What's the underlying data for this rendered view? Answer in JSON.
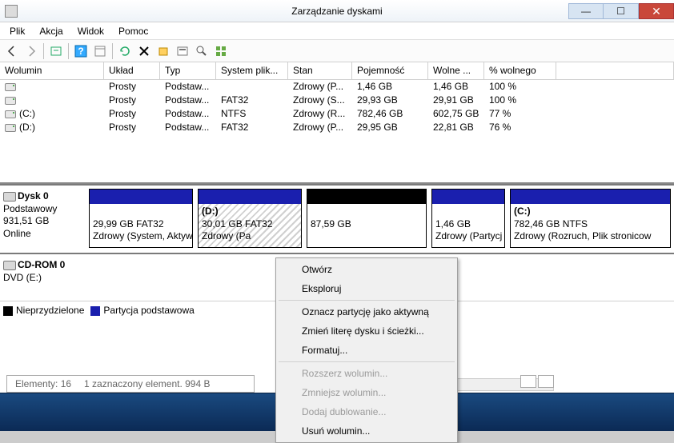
{
  "window": {
    "title": "Zarządzanie dyskami"
  },
  "menu": {
    "file": "Plik",
    "action": "Akcja",
    "view": "Widok",
    "help": "Pomoc"
  },
  "columns": {
    "volume": "Wolumin",
    "layout": "Układ",
    "type": "Typ",
    "fs": "System plik...",
    "status": "Stan",
    "capacity": "Pojemność",
    "free": "Wolne ...",
    "pct": "% wolnego"
  },
  "volumes": [
    {
      "name": "",
      "layout": "Prosty",
      "type": "Podstaw...",
      "fs": "",
      "status": "Zdrowy (P...",
      "cap": "1,46 GB",
      "free": "1,46 GB",
      "pct": "100 %"
    },
    {
      "name": "",
      "layout": "Prosty",
      "type": "Podstaw...",
      "fs": "FAT32",
      "status": "Zdrowy (S...",
      "cap": "29,93 GB",
      "free": "29,91 GB",
      "pct": "100 %"
    },
    {
      "name": "(C:)",
      "layout": "Prosty",
      "type": "Podstaw...",
      "fs": "NTFS",
      "status": "Zdrowy (R...",
      "cap": "782,46 GB",
      "free": "602,75 GB",
      "pct": "77 %"
    },
    {
      "name": "(D:)",
      "layout": "Prosty",
      "type": "Podstaw...",
      "fs": "FAT32",
      "status": "Zdrowy (P...",
      "cap": "29,95 GB",
      "free": "22,81 GB",
      "pct": "76 %"
    }
  ],
  "disk0": {
    "name": "Dysk 0",
    "type": "Podstawowy",
    "size": "931,51 GB",
    "status": "Online",
    "parts": {
      "p1": {
        "l1": "29,99 GB FAT32",
        "l2": "Zdrowy (System, Aktyw"
      },
      "p2": {
        "name": "(D:)",
        "l1": "30,01 GB FAT32",
        "l2": "Zdrowy (Pa"
      },
      "p3": {
        "l1": "87,59 GB"
      },
      "p4": {
        "l1": "1,46 GB",
        "l2": "Zdrowy (Partycj"
      },
      "p5": {
        "name": "(C:)",
        "l1": "782,46 GB NTFS",
        "l2": "Zdrowy (Rozruch, Plik stronicow"
      }
    }
  },
  "cdrom": {
    "name": "CD-ROM 0",
    "line2": "DVD (E:)"
  },
  "legend": {
    "unalloc": "Nieprzydzielone",
    "primary": "Partycja podstawowa"
  },
  "context": {
    "open": "Otwórz",
    "explore": "Eksploruj",
    "active": "Oznacz partycję jako aktywną",
    "change": "Zmień literę dysku i ścieżki...",
    "format": "Formatuj...",
    "extend": "Rozszerz wolumin...",
    "shrink": "Zmniejsz wolumin...",
    "mirror": "Dodaj dublowanie...",
    "delete": "Usuń wolumin..."
  },
  "statusbar": {
    "items": "Elementy: 16",
    "selected": "1 zaznaczony element. 994 B"
  }
}
